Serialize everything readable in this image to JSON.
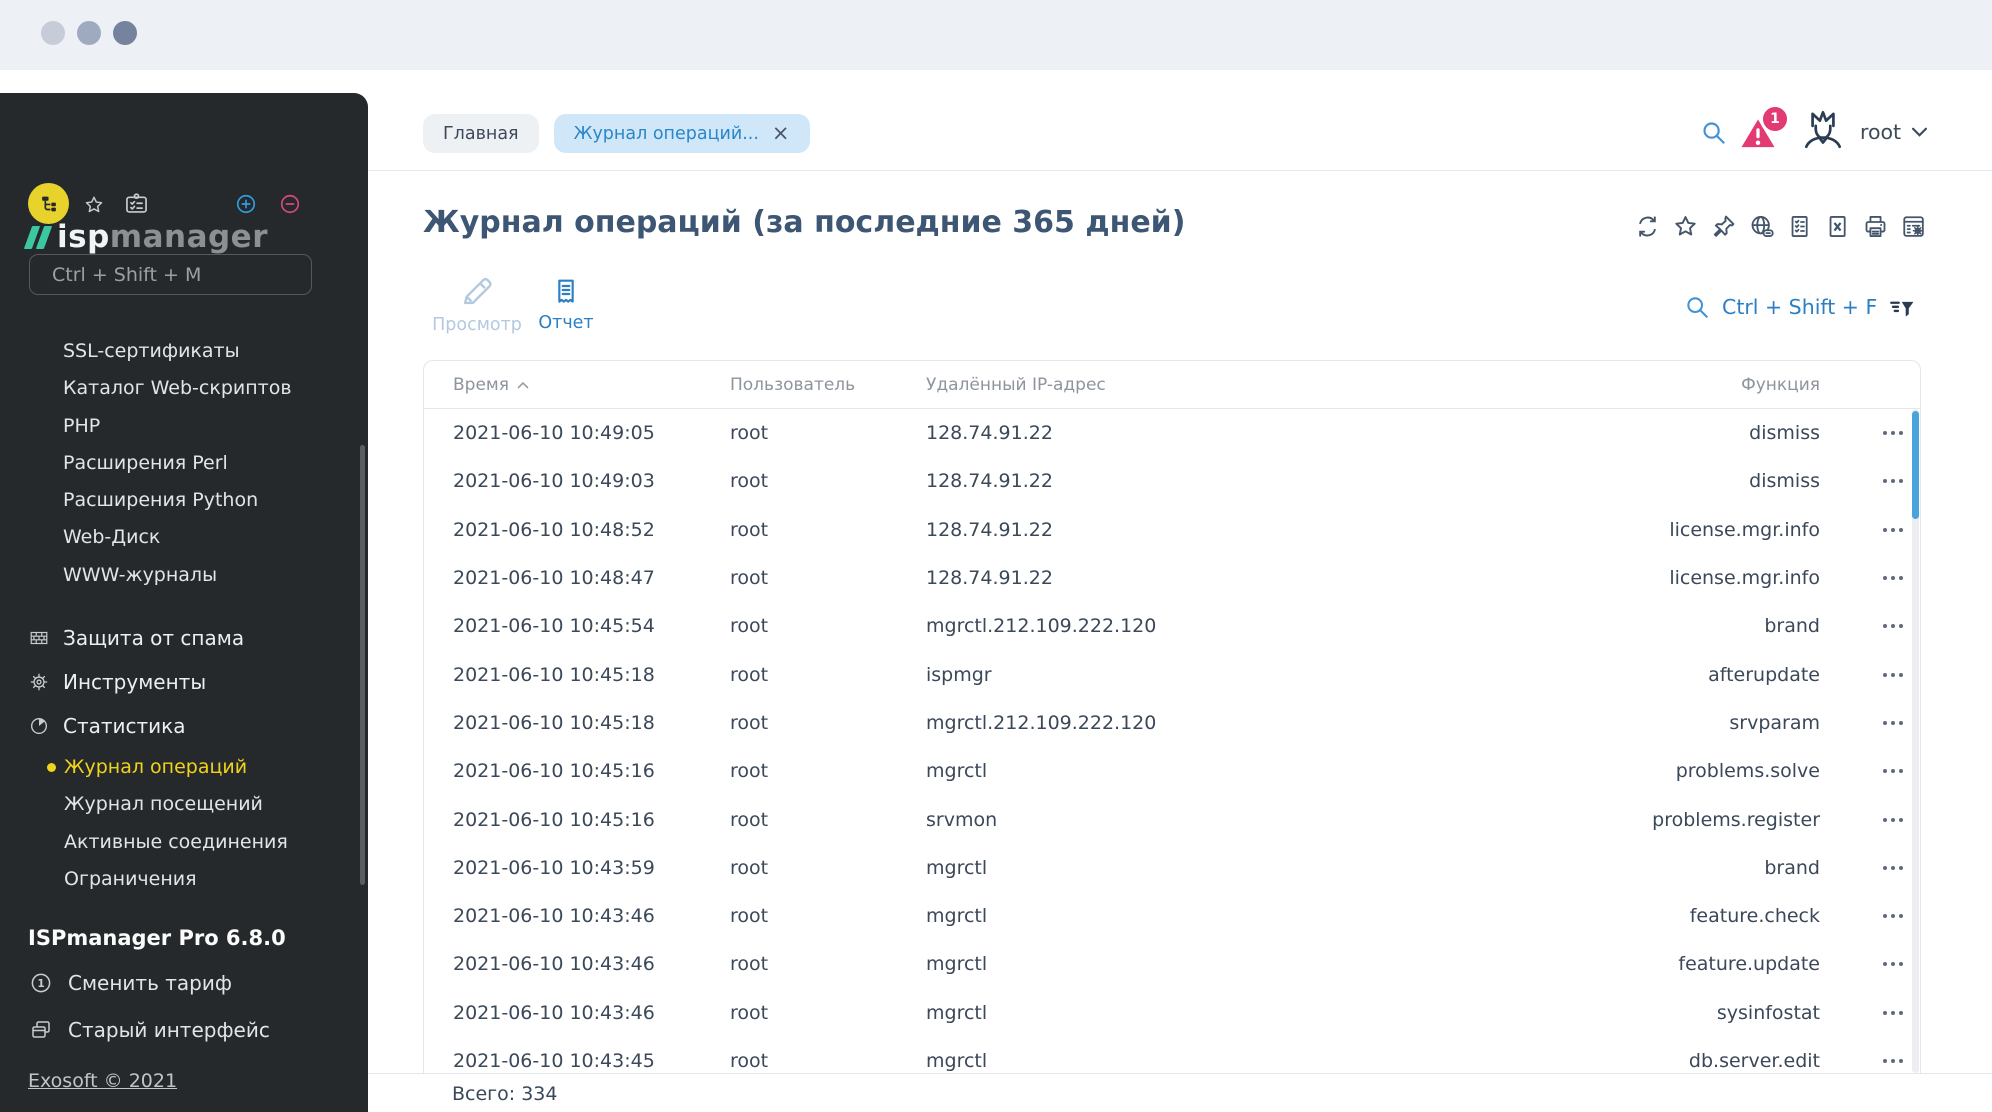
{
  "sidebar": {
    "logo_prefix": "isp",
    "logo_suffix": "manager",
    "search_placeholder": "Ctrl + Shift + M",
    "menu": [
      "SSL-сертификаты",
      "Каталог Web-скриптов",
      "PHP",
      "Расширения Perl",
      "Расширения Python",
      "Web-Диск",
      "WWW-журналы"
    ],
    "sections": [
      {
        "label": "Защита от спама",
        "icon": "wall-icon"
      },
      {
        "label": "Инструменты",
        "icon": "gear-icon"
      },
      {
        "label": "Статистика",
        "icon": "pie-chart-icon"
      }
    ],
    "submenu": [
      {
        "label": "Журнал операций",
        "active": true
      },
      {
        "label": "Журнал посещений",
        "active": false
      },
      {
        "label": "Активные соединения",
        "active": false
      },
      {
        "label": "Ограничения",
        "active": false
      }
    ],
    "version": "ISPmanager Pro 6.8.0",
    "links": [
      {
        "label": "Сменить тариф",
        "icon": "coin-icon"
      },
      {
        "label": "Старый интерфейс",
        "icon": "old-interface-icon"
      }
    ],
    "copyright": "Exosoft © 2021"
  },
  "header": {
    "breadcrumbs": {
      "home": "Главная",
      "current": "Журнал операций..."
    },
    "alert_count": "1",
    "user": "root"
  },
  "page": {
    "title": "Журнал операций (за последние 365 дней)",
    "actions": {
      "view": "Просмотр",
      "report": "Отчет"
    },
    "search_shortcut": "Ctrl + Shift + F"
  },
  "table": {
    "columns": [
      "Время",
      "Пользователь",
      "Удалённый IP-адрес",
      "Функция"
    ],
    "rows": [
      {
        "time": "2021-06-10 10:49:05",
        "user": "root",
        "ip": "128.74.91.22",
        "func": "dismiss"
      },
      {
        "time": "2021-06-10 10:49:03",
        "user": "root",
        "ip": "128.74.91.22",
        "func": "dismiss"
      },
      {
        "time": "2021-06-10 10:48:52",
        "user": "root",
        "ip": "128.74.91.22",
        "func": "license.mgr.info"
      },
      {
        "time": "2021-06-10 10:48:47",
        "user": "root",
        "ip": "128.74.91.22",
        "func": "license.mgr.info"
      },
      {
        "time": "2021-06-10 10:45:54",
        "user": "root",
        "ip": "mgrctl.212.109.222.120",
        "func": "brand"
      },
      {
        "time": "2021-06-10 10:45:18",
        "user": "root",
        "ip": "ispmgr",
        "func": "afterupdate"
      },
      {
        "time": "2021-06-10 10:45:18",
        "user": "root",
        "ip": "mgrctl.212.109.222.120",
        "func": "srvparam"
      },
      {
        "time": "2021-06-10 10:45:16",
        "user": "root",
        "ip": "mgrctl",
        "func": "problems.solve"
      },
      {
        "time": "2021-06-10 10:45:16",
        "user": "root",
        "ip": "srvmon",
        "func": "problems.register"
      },
      {
        "time": "2021-06-10 10:43:59",
        "user": "root",
        "ip": "mgrctl",
        "func": "brand"
      },
      {
        "time": "2021-06-10 10:43:46",
        "user": "root",
        "ip": "mgrctl",
        "func": "feature.check"
      },
      {
        "time": "2021-06-10 10:43:46",
        "user": "root",
        "ip": "mgrctl",
        "func": "feature.update"
      },
      {
        "time": "2021-06-10 10:43:46",
        "user": "root",
        "ip": "mgrctl",
        "func": "sysinfostat"
      },
      {
        "time": "2021-06-10 10:43:45",
        "user": "root",
        "ip": "mgrctl",
        "func": "db.server.edit"
      }
    ],
    "total": "Всего: 334"
  },
  "colors": {
    "accent_blue": "#2b7fc2",
    "link_blue": "#4193d6",
    "active_yellow": "#f0d31b",
    "alert_pink": "#e23a72",
    "title_slate": "#3d5673",
    "sidebar_bg": "#26292c",
    "scroll_thumb_blue": "#49a3dc"
  }
}
